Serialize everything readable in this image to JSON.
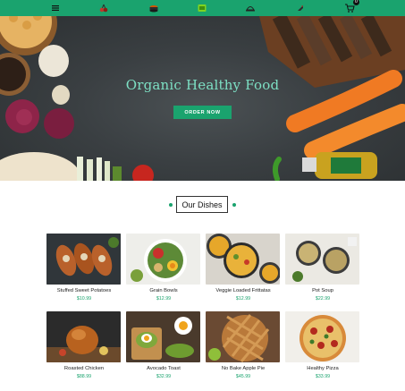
{
  "nav": {
    "menu_icon": "hamburger-menu-icon",
    "icons": [
      "cherries-icon",
      "sushi-roll-icon",
      "food-plate-icon",
      "serving-cloche-icon",
      "tag-icon"
    ],
    "cart_count": "0"
  },
  "hero": {
    "title": "Organic Healthy Food",
    "button_label": "ORDER NOW"
  },
  "section": {
    "title": "Our Dishes"
  },
  "dishes": [
    {
      "name": "Stuffed Sweet Potatoes",
      "price": "$10.99"
    },
    {
      "name": "Grain Bowls",
      "price": "$12.99"
    },
    {
      "name": "Veggie Loaded Frittatas",
      "price": "$12.99"
    },
    {
      "name": "Pot Soup",
      "price": "$22.99"
    },
    {
      "name": "Roasted Chicken",
      "price": "$88.99"
    },
    {
      "name": "Avocado Toast",
      "price": "$32.99"
    },
    {
      "name": "No Bake Apple Pie",
      "price": "$45.99"
    },
    {
      "name": "Healthy Pizza",
      "price": "$33.99"
    }
  ],
  "colors": {
    "brand_green": "#1aa36e",
    "hero_title": "#7de0c4",
    "hero_bg": "#3a3f42"
  }
}
